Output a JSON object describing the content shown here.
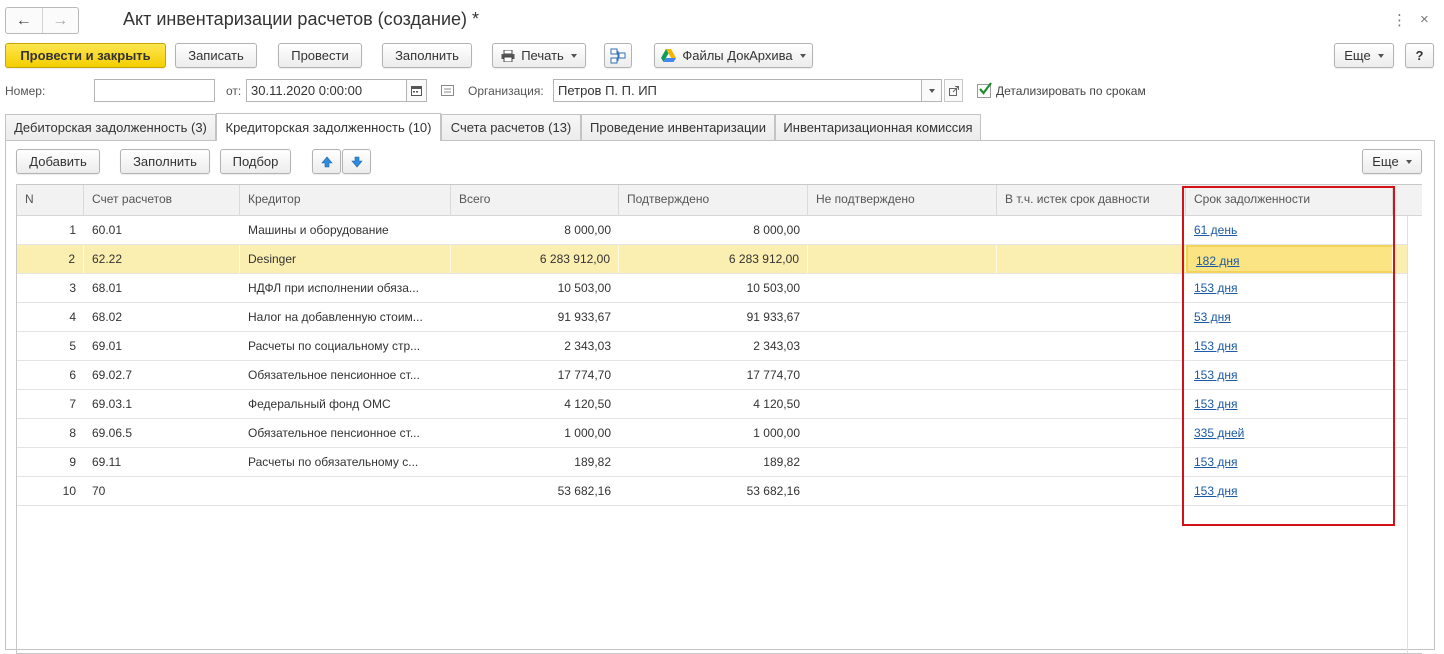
{
  "window": {
    "title": "Акт инвентаризации расчетов (создание) *",
    "back_icon": "←",
    "forward_icon": "→",
    "more_icon": "⋮",
    "close_icon": "×"
  },
  "toolbar": {
    "post_close": "Провести и закрыть",
    "save": "Записать",
    "post": "Провести",
    "fill": "Заполнить",
    "print": "Печать",
    "files": "Файлы ДокАрхива",
    "more": "Еще",
    "help": "?"
  },
  "header": {
    "number_label": "Номер:",
    "number_value": "",
    "date_label": "от:",
    "date_value": "30.11.2020  0:00:00",
    "org_label": "Организация:",
    "org_value": "Петров П. П. ИП",
    "detail_label": "Детализировать по срокам",
    "detail_checked": true
  },
  "tabs": [
    {
      "label": "Дебиторская задолженность (3)",
      "active": false
    },
    {
      "label": "Кредиторская задолженность (10)",
      "active": true
    },
    {
      "label": "Счета расчетов (13)",
      "active": false
    },
    {
      "label": "Проведение инвентаризации",
      "active": false
    },
    {
      "label": "Инвентаризационная комиссия",
      "active": false
    }
  ],
  "table_toolbar": {
    "add": "Добавить",
    "fill": "Заполнить",
    "pick": "Подбор",
    "more": "Еще"
  },
  "table": {
    "columns": [
      "N",
      "Счет расчетов",
      "Кредитор",
      "Всего",
      "Подтверждено",
      "Не подтверждено",
      "В т.ч. истек срок давности",
      "Срок задолженности"
    ],
    "rows": [
      {
        "n": "1",
        "account": "60.01",
        "creditor": "Машины и оборудование",
        "total": "8 000,00",
        "confirmed": "8 000,00",
        "unconfirmed": "",
        "expired": "",
        "term": "61 день"
      },
      {
        "n": "2",
        "account": "62.22",
        "creditor": "Desinger",
        "total": "6 283 912,00",
        "confirmed": "6 283 912,00",
        "unconfirmed": "",
        "expired": "",
        "term": "182 дня"
      },
      {
        "n": "3",
        "account": "68.01",
        "creditor": "НДФЛ при исполнении обяза...",
        "total": "10 503,00",
        "confirmed": "10 503,00",
        "unconfirmed": "",
        "expired": "",
        "term": "153 дня"
      },
      {
        "n": "4",
        "account": "68.02",
        "creditor": "Налог на добавленную стоим...",
        "total": "91 933,67",
        "confirmed": "91 933,67",
        "unconfirmed": "",
        "expired": "",
        "term": "53 дня"
      },
      {
        "n": "5",
        "account": "69.01",
        "creditor": "Расчеты по социальному стр...",
        "total": "2 343,03",
        "confirmed": "2 343,03",
        "unconfirmed": "",
        "expired": "",
        "term": "153 дня"
      },
      {
        "n": "6",
        "account": "69.02.7",
        "creditor": "Обязательное пенсионное ст...",
        "total": "17 774,70",
        "confirmed": "17 774,70",
        "unconfirmed": "",
        "expired": "",
        "term": "153 дня"
      },
      {
        "n": "7",
        "account": "69.03.1",
        "creditor": "Федеральный фонд ОМС",
        "total": "4 120,50",
        "confirmed": "4 120,50",
        "unconfirmed": "",
        "expired": "",
        "term": "153 дня"
      },
      {
        "n": "8",
        "account": "69.06.5",
        "creditor": "Обязательное пенсионное ст...",
        "total": "1 000,00",
        "confirmed": "1 000,00",
        "unconfirmed": "",
        "expired": "",
        "term": "335 дней"
      },
      {
        "n": "9",
        "account": "69.11",
        "creditor": "Расчеты по обязательному с...",
        "total": "189,82",
        "confirmed": "189,82",
        "unconfirmed": "",
        "expired": "",
        "term": "153 дня"
      },
      {
        "n": "10",
        "account": "70",
        "creditor": "",
        "total": "53 682,16",
        "confirmed": "53 682,16",
        "unconfirmed": "",
        "expired": "",
        "term": "153 дня"
      }
    ],
    "selected_row": 1
  },
  "colors": {
    "primary_button": "#f3cf00",
    "selected_row": "#fbeeb1",
    "link": "#1c5aa3",
    "highlight_box": "#d41117"
  }
}
